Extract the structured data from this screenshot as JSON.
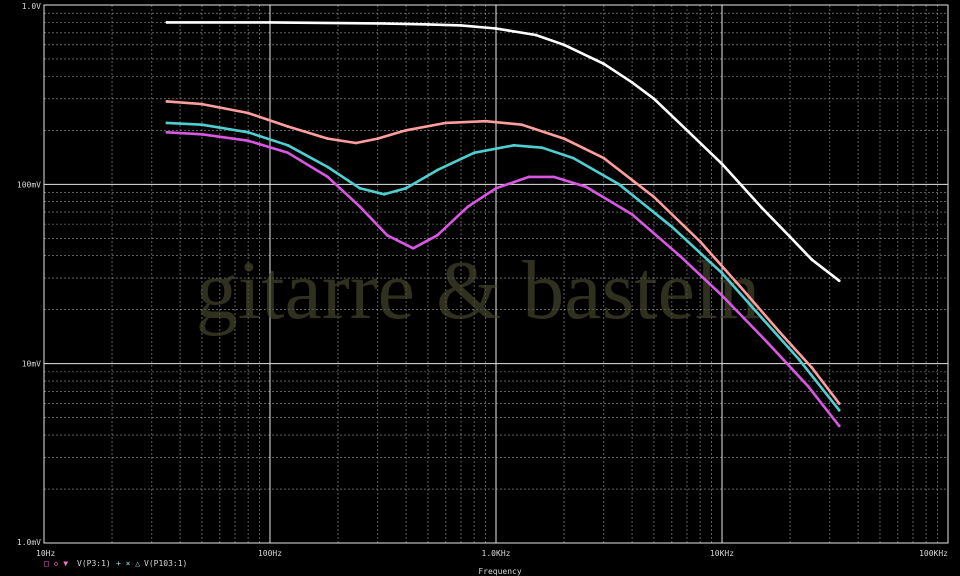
{
  "watermark": "gitarre & basteln",
  "chart_data": {
    "type": "line",
    "xscale": "log",
    "yscale": "log",
    "xlim": [
      10,
      100000
    ],
    "ylim": [
      0.001,
      1.0
    ],
    "xlabel": "Frequency",
    "ylabel": "",
    "grid": true,
    "x_tick_labels": [
      {
        "value": 10,
        "label": "10Hz"
      },
      {
        "value": 100,
        "label": "100Hz"
      },
      {
        "value": 1000,
        "label": "1.0KHz"
      },
      {
        "value": 10000,
        "label": "10KHz"
      },
      {
        "value": 100000,
        "label": "100KHz"
      }
    ],
    "y_tick_labels": [
      {
        "value": 1.0,
        "label": "1.0V"
      },
      {
        "value": 0.1,
        "label": "100mV"
      },
      {
        "value": 0.01,
        "label": "10mV"
      },
      {
        "value": 0.001,
        "label": "1.0mV"
      }
    ],
    "legend": [
      {
        "markers": "□ ◇ ▼",
        "label": "V(P3:1)"
      },
      {
        "markers": "+ × △",
        "label": "V(P103:1)"
      }
    ],
    "series": [
      {
        "color": "#ffffff",
        "points": [
          [
            35,
            0.8
          ],
          [
            100,
            0.8
          ],
          [
            300,
            0.79
          ],
          [
            500,
            0.78
          ],
          [
            700,
            0.77
          ],
          [
            1000,
            0.74
          ],
          [
            1500,
            0.68
          ],
          [
            2000,
            0.6
          ],
          [
            3000,
            0.47
          ],
          [
            4000,
            0.37
          ],
          [
            5000,
            0.3
          ],
          [
            7000,
            0.2
          ],
          [
            10000,
            0.13
          ],
          [
            15000,
            0.074
          ],
          [
            20000,
            0.051
          ],
          [
            25000,
            0.038
          ],
          [
            33000,
            0.029
          ]
        ]
      },
      {
        "color": "#ff9e9e",
        "points": [
          [
            35,
            0.29
          ],
          [
            50,
            0.28
          ],
          [
            80,
            0.25
          ],
          [
            120,
            0.21
          ],
          [
            180,
            0.18
          ],
          [
            240,
            0.17
          ],
          [
            300,
            0.18
          ],
          [
            400,
            0.2
          ],
          [
            600,
            0.22
          ],
          [
            900,
            0.225
          ],
          [
            1300,
            0.215
          ],
          [
            2000,
            0.18
          ],
          [
            3000,
            0.14
          ],
          [
            5000,
            0.085
          ],
          [
            8000,
            0.048
          ],
          [
            12000,
            0.027
          ],
          [
            18000,
            0.015
          ],
          [
            25000,
            0.0095
          ],
          [
            33000,
            0.006
          ]
        ]
      },
      {
        "color": "#4ecfd2",
        "points": [
          [
            35,
            0.22
          ],
          [
            50,
            0.215
          ],
          [
            80,
            0.195
          ],
          [
            120,
            0.165
          ],
          [
            180,
            0.125
          ],
          [
            250,
            0.095
          ],
          [
            320,
            0.088
          ],
          [
            400,
            0.095
          ],
          [
            550,
            0.12
          ],
          [
            800,
            0.15
          ],
          [
            1200,
            0.165
          ],
          [
            1600,
            0.16
          ],
          [
            2200,
            0.14
          ],
          [
            3500,
            0.1
          ],
          [
            6000,
            0.058
          ],
          [
            10000,
            0.032
          ],
          [
            15000,
            0.018
          ],
          [
            22000,
            0.0105
          ],
          [
            33000,
            0.0055
          ]
        ]
      },
      {
        "color": "#d957e3",
        "points": [
          [
            35,
            0.195
          ],
          [
            50,
            0.19
          ],
          [
            80,
            0.175
          ],
          [
            120,
            0.15
          ],
          [
            180,
            0.11
          ],
          [
            250,
            0.075
          ],
          [
            330,
            0.052
          ],
          [
            430,
            0.044
          ],
          [
            550,
            0.052
          ],
          [
            750,
            0.075
          ],
          [
            1000,
            0.095
          ],
          [
            1400,
            0.11
          ],
          [
            1800,
            0.11
          ],
          [
            2500,
            0.097
          ],
          [
            4000,
            0.068
          ],
          [
            6500,
            0.04
          ],
          [
            10000,
            0.024
          ],
          [
            16000,
            0.013
          ],
          [
            24000,
            0.0075
          ],
          [
            33000,
            0.0045
          ]
        ]
      }
    ]
  }
}
